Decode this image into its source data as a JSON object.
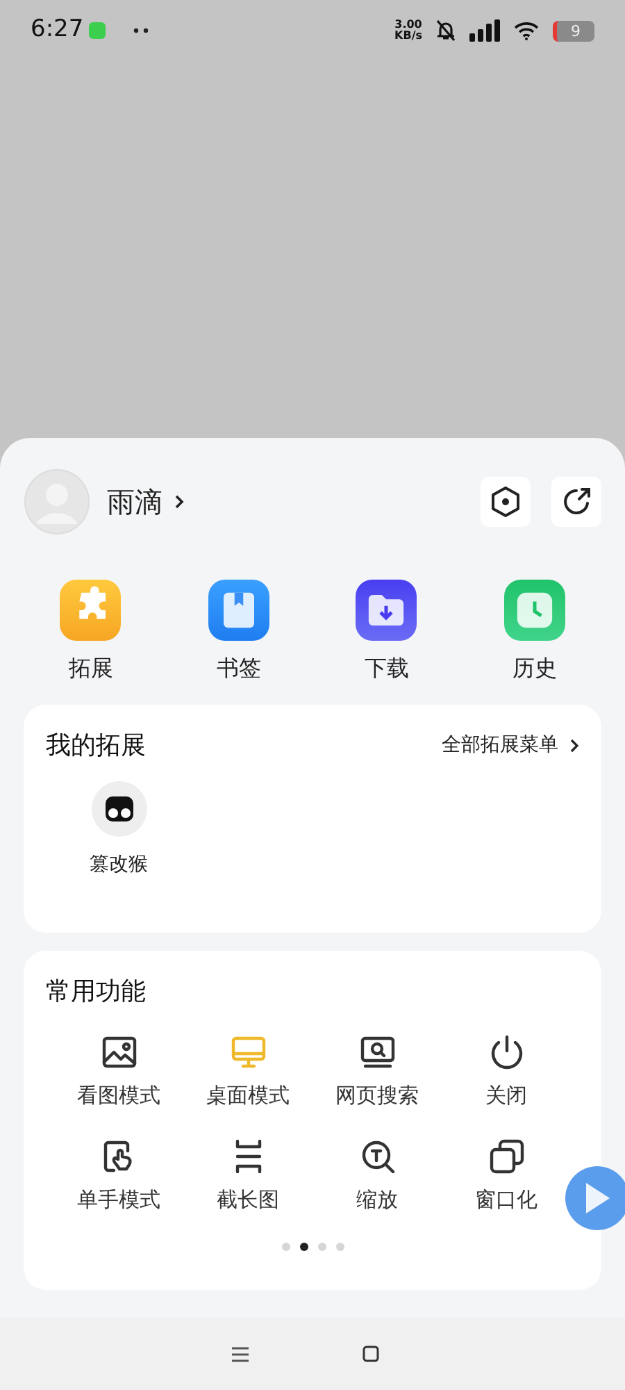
{
  "status_bar": {
    "time": "6:27",
    "net_speed_value": "3.00",
    "net_speed_unit": "KB/s",
    "battery": "9"
  },
  "profile": {
    "name": "雨滴"
  },
  "quick_actions": [
    {
      "label": "拓展",
      "kind": "extensions"
    },
    {
      "label": "书签",
      "kind": "bookmarks"
    },
    {
      "label": "下载",
      "kind": "downloads"
    },
    {
      "label": "历史",
      "kind": "history"
    }
  ],
  "my_extensions": {
    "title": "我的拓展",
    "link": "全部拓展菜单",
    "items": [
      {
        "label": "篡改猴"
      }
    ]
  },
  "common_functions": {
    "title": "常用功能",
    "items": [
      {
        "label": "看图模式",
        "kind": "image",
        "selected": false
      },
      {
        "label": "桌面模式",
        "kind": "desktop",
        "selected": true
      },
      {
        "label": "网页搜索",
        "kind": "search",
        "selected": false
      },
      {
        "label": "关闭",
        "kind": "power",
        "selected": false
      },
      {
        "label": "单手模式",
        "kind": "one-hand",
        "selected": false
      },
      {
        "label": "截长图",
        "kind": "long-screenshot",
        "selected": false
      },
      {
        "label": "缩放",
        "kind": "zoom",
        "selected": false
      },
      {
        "label": "窗口化",
        "kind": "window",
        "selected": false
      }
    ],
    "pages": [
      {
        "selected": false
      },
      {
        "selected": true
      },
      {
        "selected": false
      },
      {
        "selected": false
      }
    ]
  }
}
